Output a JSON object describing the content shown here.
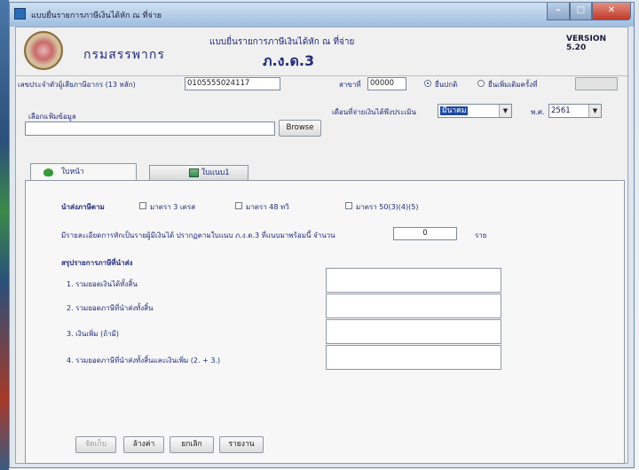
{
  "window": {
    "title": "แบบยื่นรายการภาษีเงินได้หัก ณ ที่จ่าย",
    "min": "–",
    "max": "□",
    "close": "✕"
  },
  "header": {
    "org": "กรมสรรพากร",
    "form_title": "แบบยื่นรายการภาษีเงินได้หัก ณ ที่จ่าย",
    "form_code": "ภ.ง.ด.3",
    "version": "VERSION 5.20"
  },
  "taxid": {
    "label": "เลขประจำตัวผู้เสียภาษีอากร (13 หลัก)",
    "value": "0105555024117",
    "branch_label": "สาขาที่",
    "branch_value": "00000",
    "normal_label": "ยื่นปกติ",
    "additional_label": "ยื่นเพิ่มเติมครั้งที่",
    "additional_value": ""
  },
  "import": {
    "label": "เลือกแฟ้มข้อมูล",
    "path": "",
    "browse": "Browse"
  },
  "period": {
    "label": "เดือนที่จ่ายเงินได้พึงประเมิน",
    "month": "มีนาคม",
    "year_label": "พ.ศ.",
    "year": "2561",
    "arrow": "▼"
  },
  "tabs": [
    {
      "label": "ใบหน้า",
      "icon": "green-page-icon"
    },
    {
      "label": "ใบแนบ1",
      "icon": "sheet-icon"
    }
  ],
  "front": {
    "submit_label": "นำส่งภาษีตาม",
    "sections": [
      "มาตรา 3 เตรส",
      "มาตรา 48 ทวิ",
      "มาตรา 50(3)(4)(5)"
    ],
    "attach_text": "มีรายละเอียดการหักเป็นรายผู้มีเงินได้ ปรากฏตามใบแนบ ภ.ง.ด.3 ที่แนบมาพร้อมนี้ จำนวน",
    "attach_count": "0",
    "attach_unit": "ราย",
    "summary_title": "สรุปรายการภาษีที่นำส่ง",
    "summary_items": [
      "1. รวมยอดเงินได้ทั้งสิ้น",
      "2. รวมยอดภาษีที่นำส่งทั้งสิ้น",
      "3. เงินเพิ่ม (ถ้ามี)",
      "4. รวมยอดภาษีที่นำส่งทั้งสิ้นและเงินเพิ่ม (2. + 3.)"
    ],
    "summary_values": [
      "",
      "",
      "",
      ""
    ]
  },
  "buttons": {
    "save": "จัดเก็บ",
    "clear": "ล้างค่า",
    "cancel": "ยกเลิก",
    "report": "รายงาน"
  }
}
